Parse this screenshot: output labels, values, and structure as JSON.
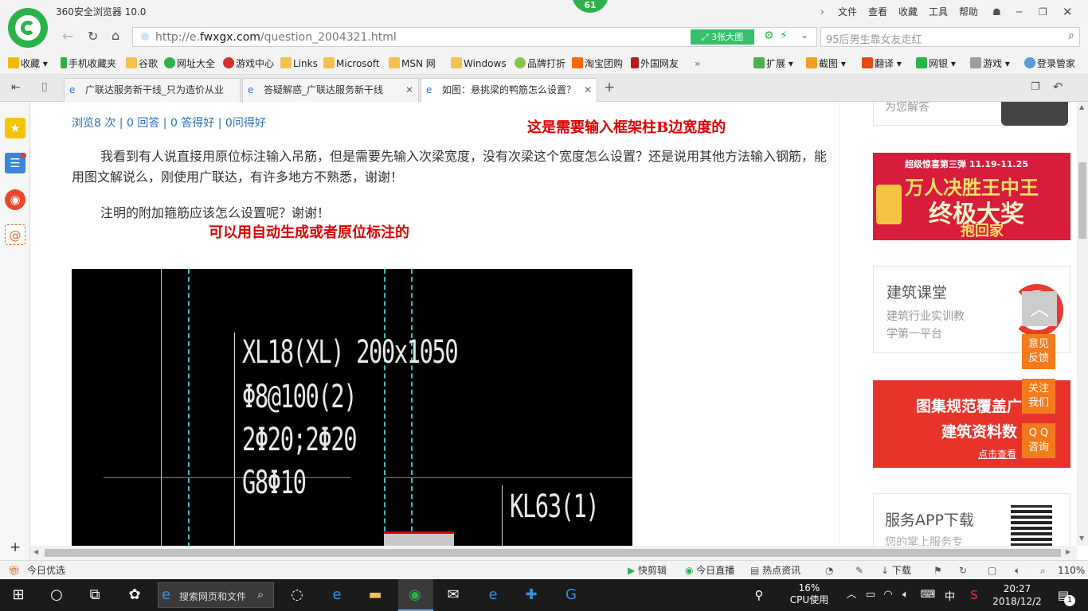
{
  "browser": {
    "title": "360安全浏览器 10.0",
    "menu": [
      "文件",
      "查看",
      "收藏",
      "工具",
      "帮助"
    ],
    "notif_badge": "61",
    "url_prefix": "http://e.",
    "url_domain": "fwxgx.com",
    "url_path": "/question_2004321.html",
    "big_image_label": "3张大图",
    "search_placeholder": "95后男生靠女友走红"
  },
  "bookmarks": [
    "收藏",
    "手机收藏夹",
    "谷歌",
    "网址大全",
    "游戏中心",
    "Links",
    "Microsoft",
    "MSN 网",
    "Windows",
    "品牌打折",
    "淘宝团购",
    "外国网友"
  ],
  "bookmarks_right": [
    "扩展",
    "截图",
    "翻译",
    "网银",
    "游戏",
    "登录管家"
  ],
  "tabs": [
    {
      "label": "广联达服务新干线_只为造价从业"
    },
    {
      "label": "答疑解惑_广联达服务新干线"
    },
    {
      "label": "如图：悬挑梁的鸭筋怎么设置？"
    }
  ],
  "page": {
    "stats": "浏览8 次 | 0 回答 | 0 答得好 | 0问得好",
    "annotation1": "这是需要输入框架柱B边宽度的",
    "question_p1": "我看到有人说直接用原位标注输入吊筋，但是需要先输入次梁宽度，没有次梁这个宽度怎么设置？还是说用其他方法输入钢筋，能用图文解说么，刚使用广联达，有许多地方不熟悉，谢谢！",
    "question_p2": "注明的附加箍筋应该怎么设置呢？谢谢！",
    "annotation2": "可以用自动生成或者原位标注的",
    "cad_lines": [
      "XL18(XL) 200x1050",
      "Φ8@100(2)",
      "2Φ20;2Φ20",
      "G8Φ10"
    ],
    "cad_kl": "KL63(1)"
  },
  "ads": {
    "top_text": "为您解答",
    "banner1_top": "超级惊喜第三弹  11.19-11.25",
    "banner1_line1": "万人决胜王中王",
    "banner1_line2": "终极大奖",
    "banner1_line3": "抱回家",
    "course_title": "建筑课堂",
    "course_sub1": "建筑行业实训教",
    "course_sub2": "学第一平台",
    "banner2_line1": "图集规范覆盖广",
    "banner2_line2": "建筑资料数",
    "banner2_link": "点击查看",
    "app_title": "服务APP下载",
    "app_sub": "您的掌上服务专"
  },
  "float_buttons": [
    "意见\n反馈",
    "关注\n我们",
    "Q Q\n咨询"
  ],
  "status": {
    "left": "今日优选",
    "items": [
      "快剪辑",
      "今日直播",
      "热点资讯",
      "下载"
    ],
    "zoom": "110%"
  },
  "taskbar": {
    "search": "搜索网页和文件",
    "cpu_pct": "16%",
    "cpu_label": "CPU使用",
    "ime": "中",
    "time": "20:27",
    "date": "2018/12/2",
    "notif_count": "1"
  },
  "colors": {
    "accent_green": "#2bb24c",
    "annotation_red": "#e00000",
    "link_blue": "#2a6ebb",
    "float_orange": "#f37b1d"
  }
}
